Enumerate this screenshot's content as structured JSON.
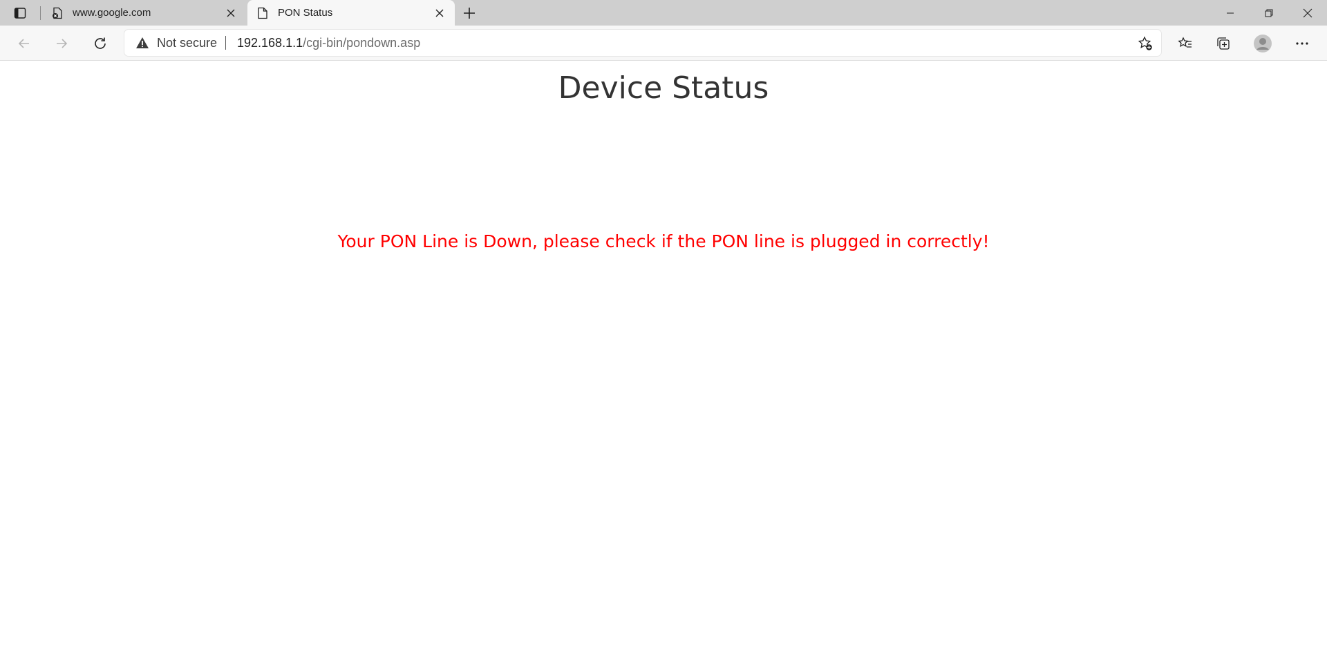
{
  "tabs": [
    {
      "title": "www.google.com",
      "favicon": "blocked-page-icon",
      "active": false
    },
    {
      "title": "PON Status",
      "favicon": "page-icon",
      "active": true
    }
  ],
  "address_bar": {
    "security_label": "Not secure",
    "url_host": "192.168.1.1",
    "url_path": "/cgi-bin/pondown.asp"
  },
  "page": {
    "title": "Device Status",
    "message": "Your PON Line is Down, please check if the PON line is plugged in correctly!",
    "message_color": "#ff0000"
  }
}
